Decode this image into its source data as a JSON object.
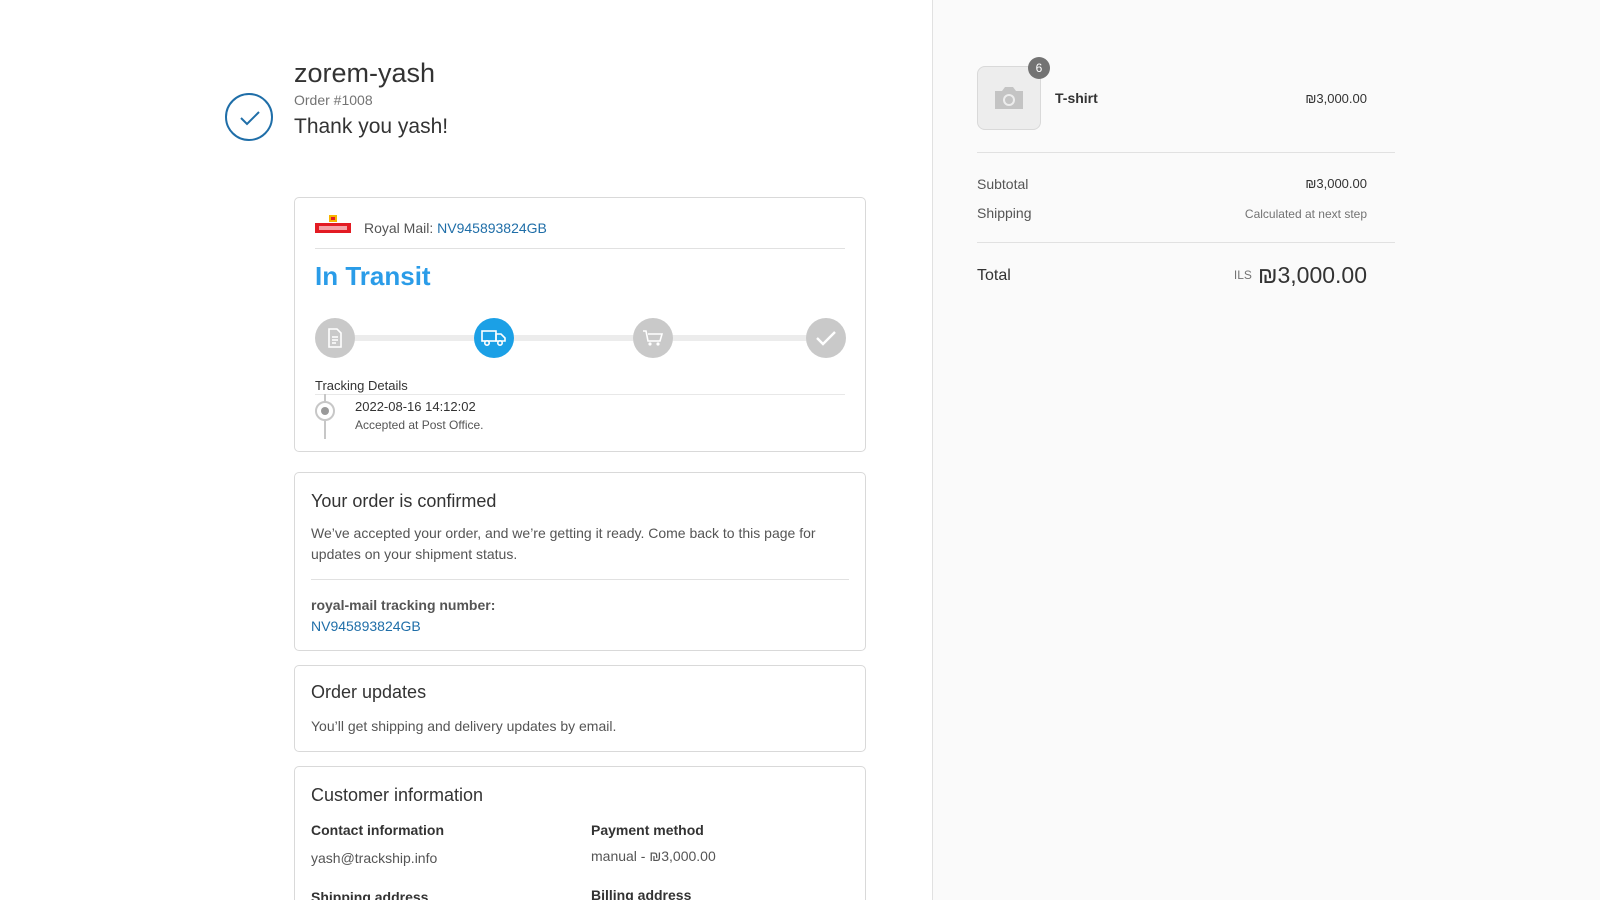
{
  "header": {
    "shop_name": "zorem-yash",
    "order_number": "Order #1008",
    "thank_you": "Thank you yash!"
  },
  "tracking": {
    "carrier_label": "Royal Mail:",
    "tracking_number": "NV945893824GB",
    "status": "In Transit",
    "steps": [
      {
        "icon": "document-icon",
        "active": false
      },
      {
        "icon": "truck-icon",
        "active": true
      },
      {
        "icon": "cart-icon",
        "active": false
      },
      {
        "icon": "checkmark-icon",
        "active": false
      }
    ],
    "details_label": "Tracking Details",
    "event": {
      "datetime": "2022-08-16 14:12:02",
      "description": "Accepted at Post Office."
    },
    "status_color": "#1ba0e6"
  },
  "confirmation": {
    "title": "Your order is confirmed",
    "body": "We’ve accepted your order, and we’re getting it ready. Come back to this page for updates on your shipment status.",
    "tracking_label": "royal-mail tracking number:",
    "tracking_number": "NV945893824GB"
  },
  "updates": {
    "title": "Order updates",
    "body": "You’ll get shipping and delivery updates by email."
  },
  "customer": {
    "title": "Customer information",
    "contact_heading": "Contact information",
    "contact_email": "yash@trackship.info",
    "payment_heading": "Payment method",
    "payment_value": "manual - ₪3,000.00",
    "shipping_heading": "Shipping address",
    "billing_heading": "Billing address"
  },
  "summary": {
    "product": {
      "name": "T-shirt",
      "price": "₪3,000.00",
      "quantity": "6"
    },
    "subtotal_label": "Subtotal",
    "subtotal_value": "₪3,000.00",
    "shipping_label": "Shipping",
    "shipping_value": "Calculated at next step",
    "total_label": "Total",
    "total_currency": "ILS",
    "total_value": "₪3,000.00"
  },
  "colors": {
    "accent": "#1f6ea8",
    "status_blue": "#2a9ce8",
    "sidebar_bg": "#fafafa"
  }
}
